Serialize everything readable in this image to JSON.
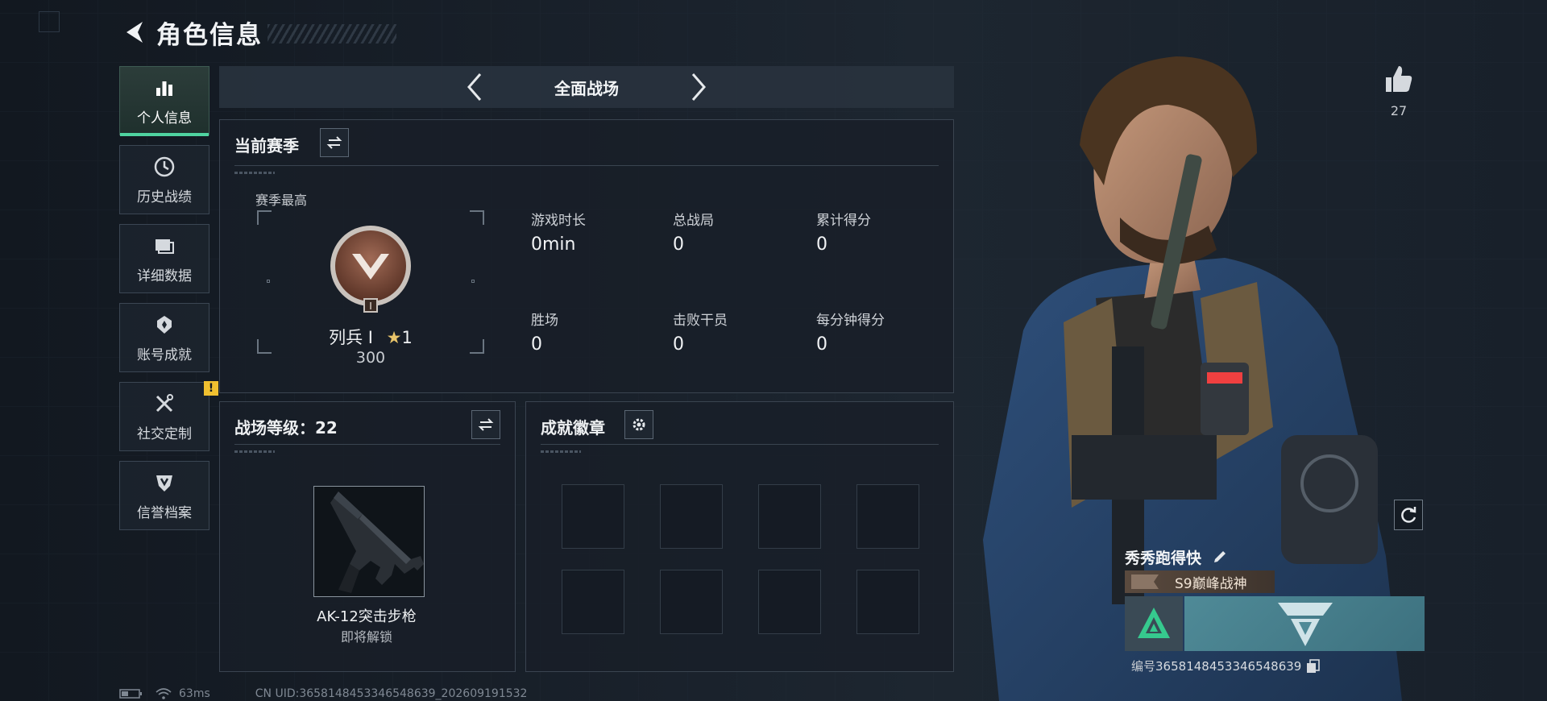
{
  "header": {
    "title": "角色信息"
  },
  "sidebar": {
    "items": [
      {
        "label": "个人信息",
        "icon": "bar-chart-icon",
        "active": true
      },
      {
        "label": "历史战绩",
        "icon": "clock-icon"
      },
      {
        "label": "详细数据",
        "icon": "folder-icon"
      },
      {
        "label": "账号成就",
        "icon": "achievement-icon"
      },
      {
        "label": "社交定制",
        "icon": "tools-icon",
        "badge": "!"
      },
      {
        "label": "信誉档案",
        "icon": "shield-icon"
      }
    ]
  },
  "mode": {
    "label": "全面战场"
  },
  "season": {
    "title": "当前赛季",
    "subtitle": "赛季最高",
    "rank_name": "列兵 I",
    "rank_star": "1",
    "rank_score": "300",
    "rank_badge_numeral": "I",
    "stats": [
      {
        "label": "游戏时长",
        "value": "0min"
      },
      {
        "label": "总战局",
        "value": "0"
      },
      {
        "label": "累计得分",
        "value": "0"
      },
      {
        "label": "胜场",
        "value": "0"
      },
      {
        "label": "击败干员",
        "value": "0"
      },
      {
        "label": "每分钟得分",
        "value": "0"
      }
    ]
  },
  "battlefield": {
    "title": "战场等级：22",
    "weapon_name": "AK-12突击步枪",
    "weapon_status": "即将解锁"
  },
  "badges": {
    "title": "成就徽章",
    "slots": 8
  },
  "profile": {
    "like_count": "27",
    "player_name": "秀秀跑得快",
    "player_title": "S9巅峰战神",
    "id_label": "编号",
    "id_value": "3658148453346548639"
  },
  "status": {
    "ping": "63ms",
    "uid": "CN UID:3658148453346548639_202609191532"
  },
  "colors": {
    "accent": "#4fd3a0",
    "alert": "#f0c030",
    "panel": "#18202a"
  }
}
